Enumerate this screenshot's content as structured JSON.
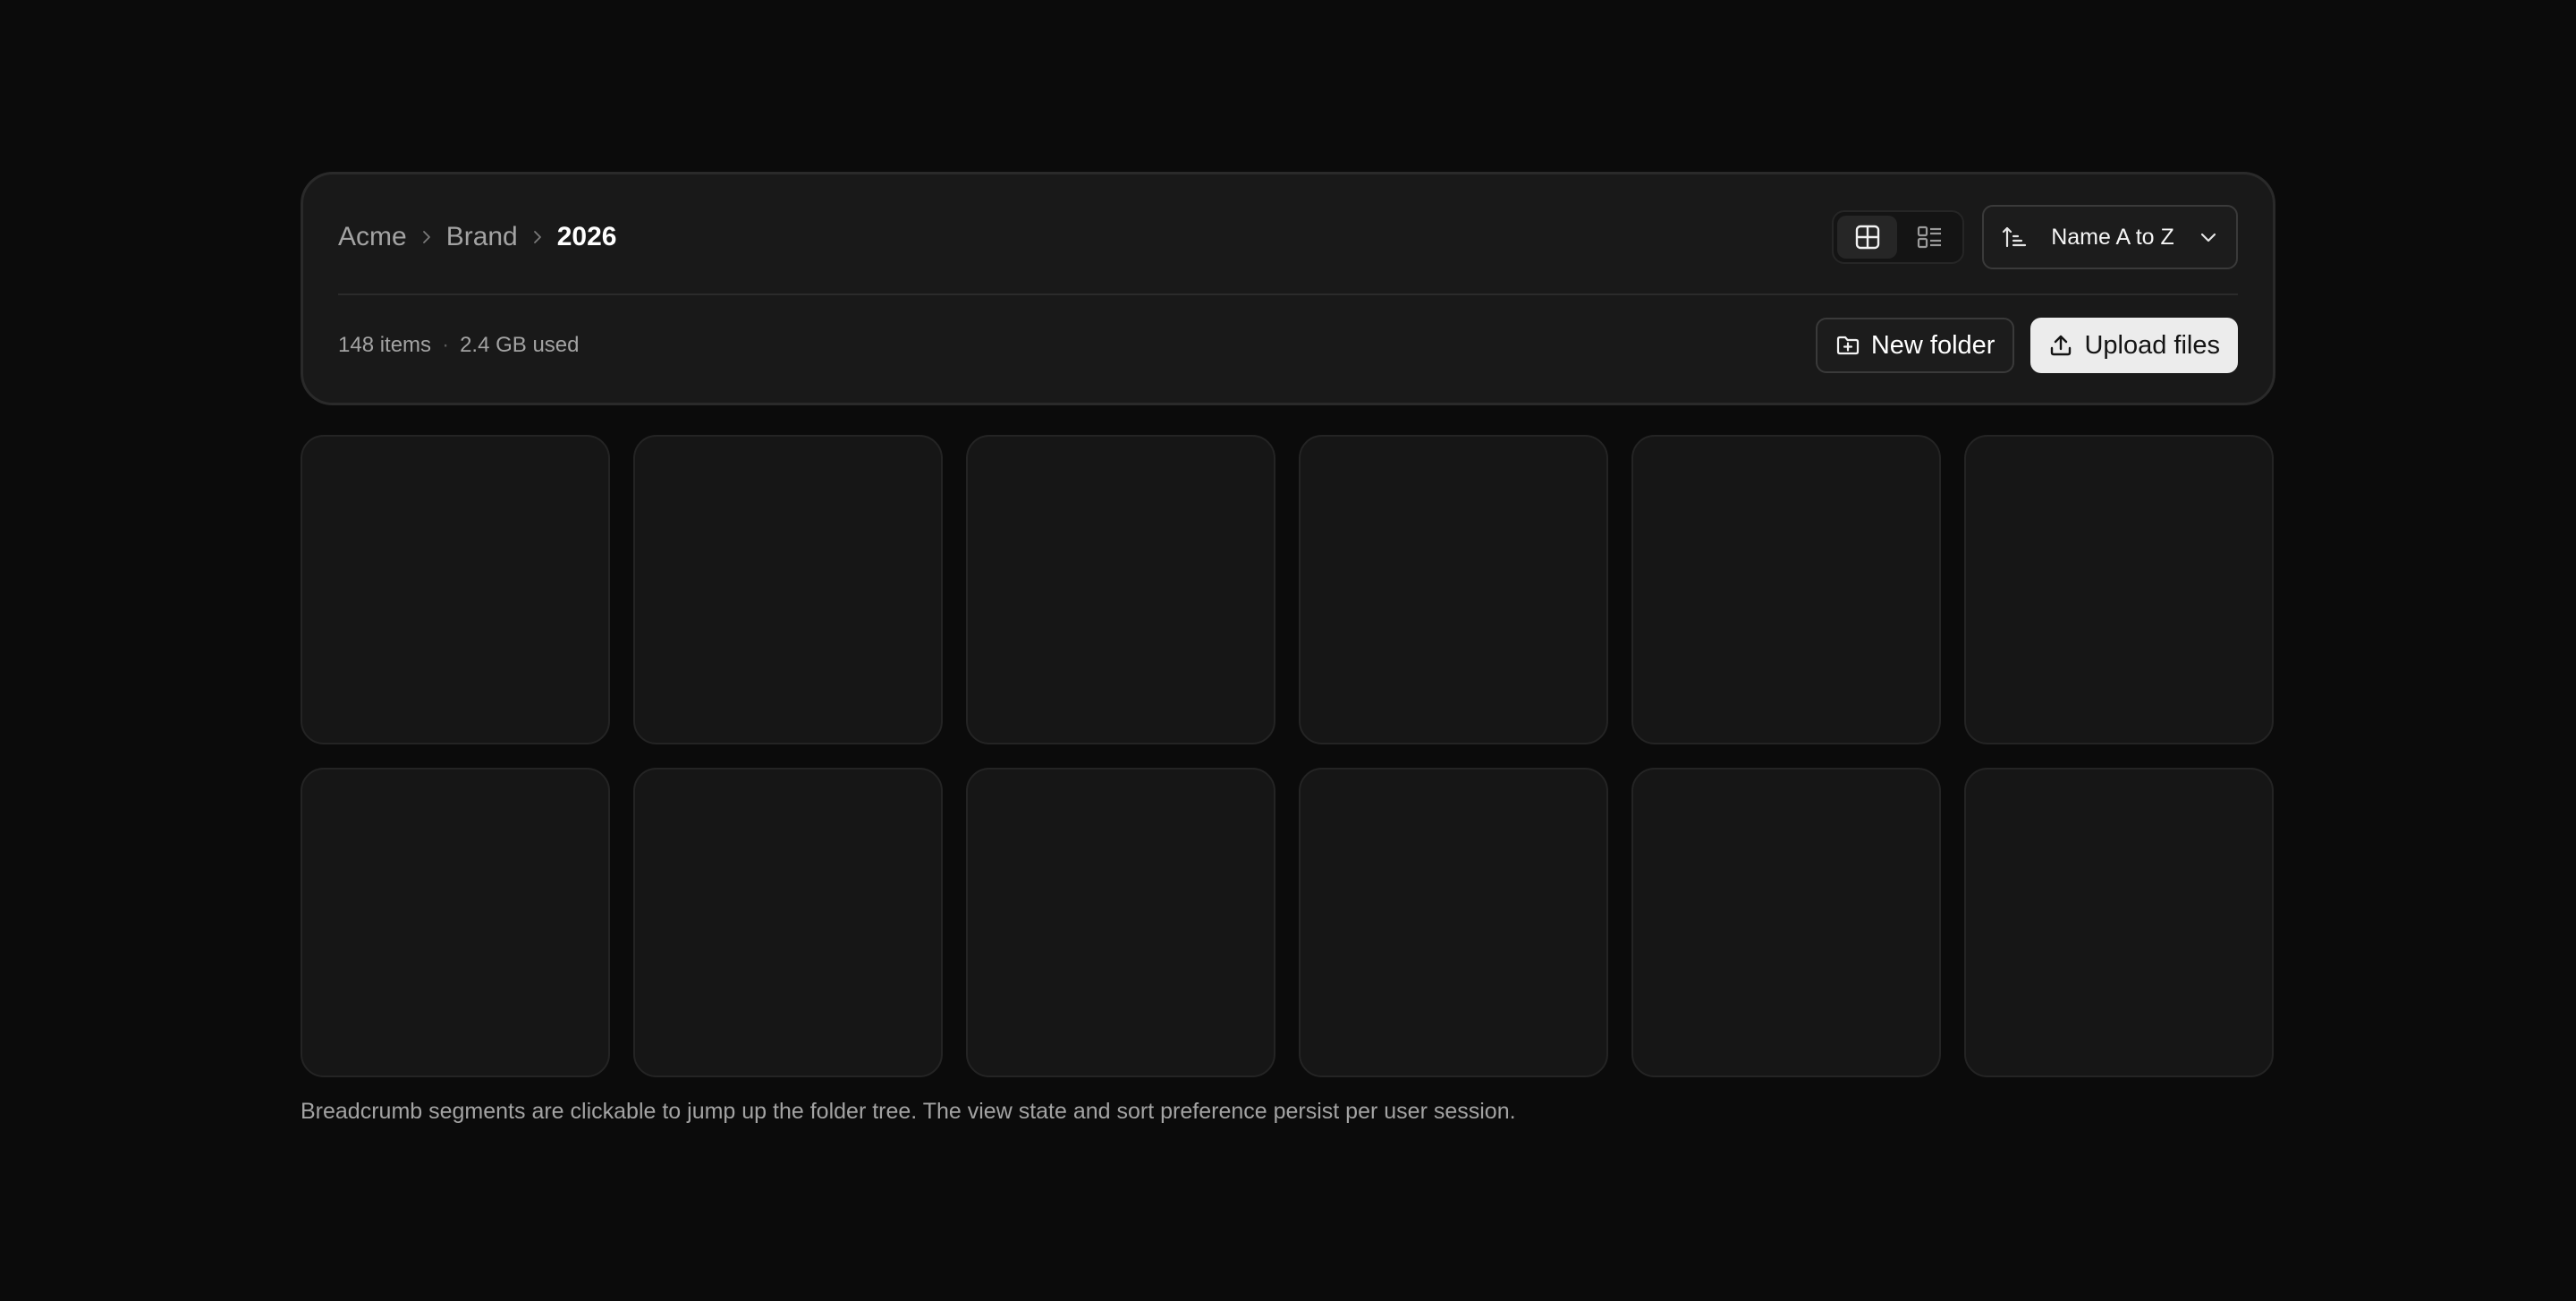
{
  "breadcrumb": {
    "items": [
      "Acme",
      "Brand",
      "2026"
    ]
  },
  "view_toggle": {
    "active": "grid",
    "options": [
      "grid-view-icon",
      "list-view-icon"
    ]
  },
  "sort": {
    "label": "Name A to Z",
    "icon": "sort-ascending-icon"
  },
  "meta": {
    "items_count": "148 items",
    "separator": "·",
    "storage": "2.4 GB used"
  },
  "actions": {
    "new_folder_label": "New folder",
    "new_folder_icon": "folder-plus-icon",
    "upload_label": "Upload files",
    "upload_icon": "upload-icon"
  },
  "grid": {
    "tile_count": 12
  },
  "footnote": "Breadcrumb segments are clickable to jump up the folder tree. The view state and sort preference persist per user session.",
  "colors": {
    "background": "#0b0b0b",
    "card": "#191919",
    "tile": "#161616",
    "primary_button": "#ececec",
    "muted_text": "#a3a3a3"
  }
}
